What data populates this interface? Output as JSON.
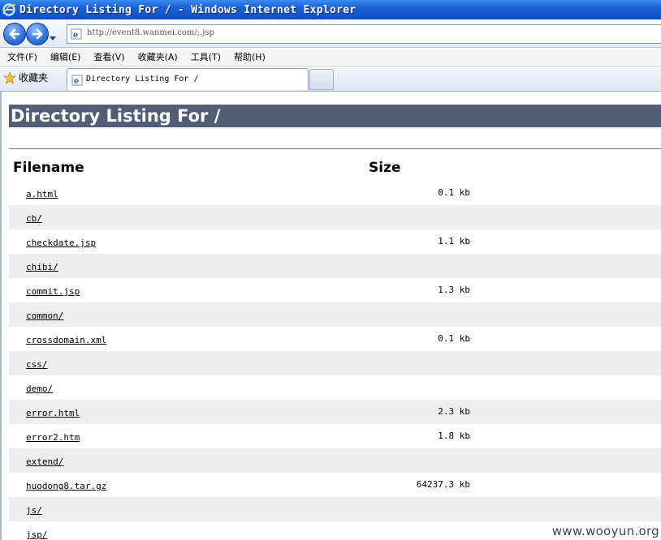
{
  "window": {
    "title": "Directory Listing For / - Windows Internet Explorer"
  },
  "address_bar": {
    "url": "http://event8.wanmei.com/;.jsp"
  },
  "menu": {
    "items": [
      "文件(F)",
      "编辑(E)",
      "查看(V)",
      "收藏夹(A)",
      "工具(T)",
      "帮助(H)"
    ]
  },
  "tabs": {
    "favorites_label": "收藏夹",
    "active_title": "Directory Listing For /"
  },
  "page": {
    "heading": "Directory Listing For /",
    "columns": {
      "filename": "Filename",
      "size": "Size"
    },
    "files": [
      {
        "name": "a.html",
        "size": "0.1 kb"
      },
      {
        "name": "cb/",
        "size": ""
      },
      {
        "name": "checkdate.jsp",
        "size": "1.1 kb"
      },
      {
        "name": "chibi/",
        "size": ""
      },
      {
        "name": "commit.jsp",
        "size": "1.3 kb"
      },
      {
        "name": "common/",
        "size": ""
      },
      {
        "name": "crossdomain.xml",
        "size": "0.1 kb"
      },
      {
        "name": "css/",
        "size": ""
      },
      {
        "name": "demo/",
        "size": ""
      },
      {
        "name": "error.html",
        "size": "2.3 kb"
      },
      {
        "name": "error2.htm",
        "size": "1.8 kb"
      },
      {
        "name": "extend/",
        "size": ""
      },
      {
        "name": "huodong8.tar.gz",
        "size": "64237.3 kb"
      },
      {
        "name": "js/",
        "size": ""
      },
      {
        "name": "jsp/",
        "size": ""
      }
    ]
  },
  "watermark": "www.wooyun.org",
  "colors": {
    "heading_bg": "#525d76",
    "row_shade": "#eeeeee",
    "titlebar": "#1a5fd8"
  }
}
